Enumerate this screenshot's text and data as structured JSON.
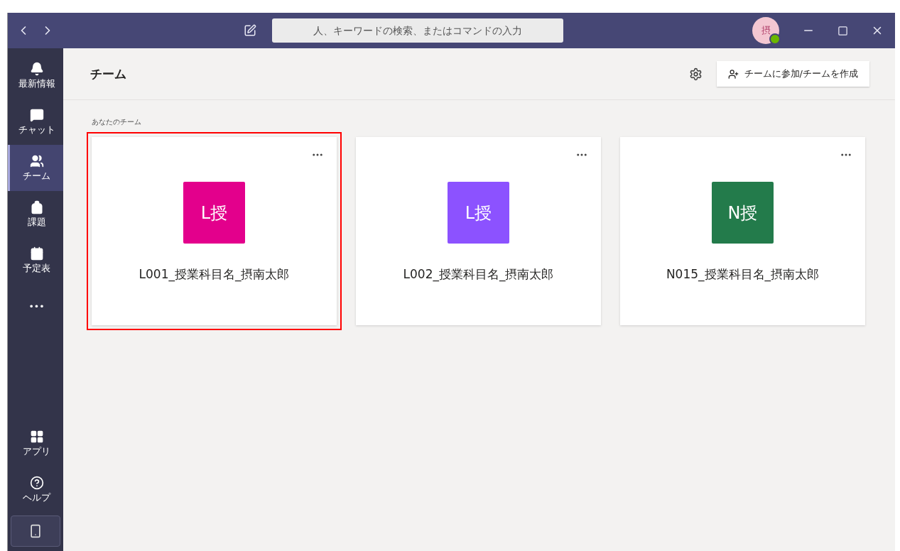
{
  "title_bar": {
    "search": {
      "placeholder": "人、キーワードの検索、またはコマンドの入力"
    },
    "avatar": "摂"
  },
  "sidebar": {
    "items": [
      {
        "label": "最新情報",
        "kind": "bell",
        "selected": false
      },
      {
        "label": "チャット",
        "kind": "chat",
        "selected": false
      },
      {
        "label": "チーム",
        "kind": "teams",
        "selected": true
      },
      {
        "label": "課題",
        "kind": "bag",
        "selected": false
      },
      {
        "label": "予定表",
        "kind": "calendar",
        "selected": false
      },
      {
        "label": "•••",
        "kind": "more",
        "selected": false
      }
    ],
    "bottom_items": [
      {
        "label": "アプリ",
        "kind": "apps"
      },
      {
        "label": "ヘルプ",
        "kind": "help"
      }
    ]
  },
  "header": {
    "title": "チーム",
    "join_button": "チームに参加/チームを作成"
  },
  "section_title": "あなたのチーム",
  "teams": [
    {
      "initials": "L授",
      "name": "L001_授業科目名_摂南太郎",
      "color": "#e3008c",
      "highlighted": true
    },
    {
      "initials": "L授",
      "name": "L002_授業科目名_摂南太郎",
      "color": "#8c52ff",
      "highlighted": false
    },
    {
      "initials": "N授",
      "name": "N015_授業科目名_摂南太郎",
      "color": "#237b4b",
      "highlighted": false
    }
  ]
}
